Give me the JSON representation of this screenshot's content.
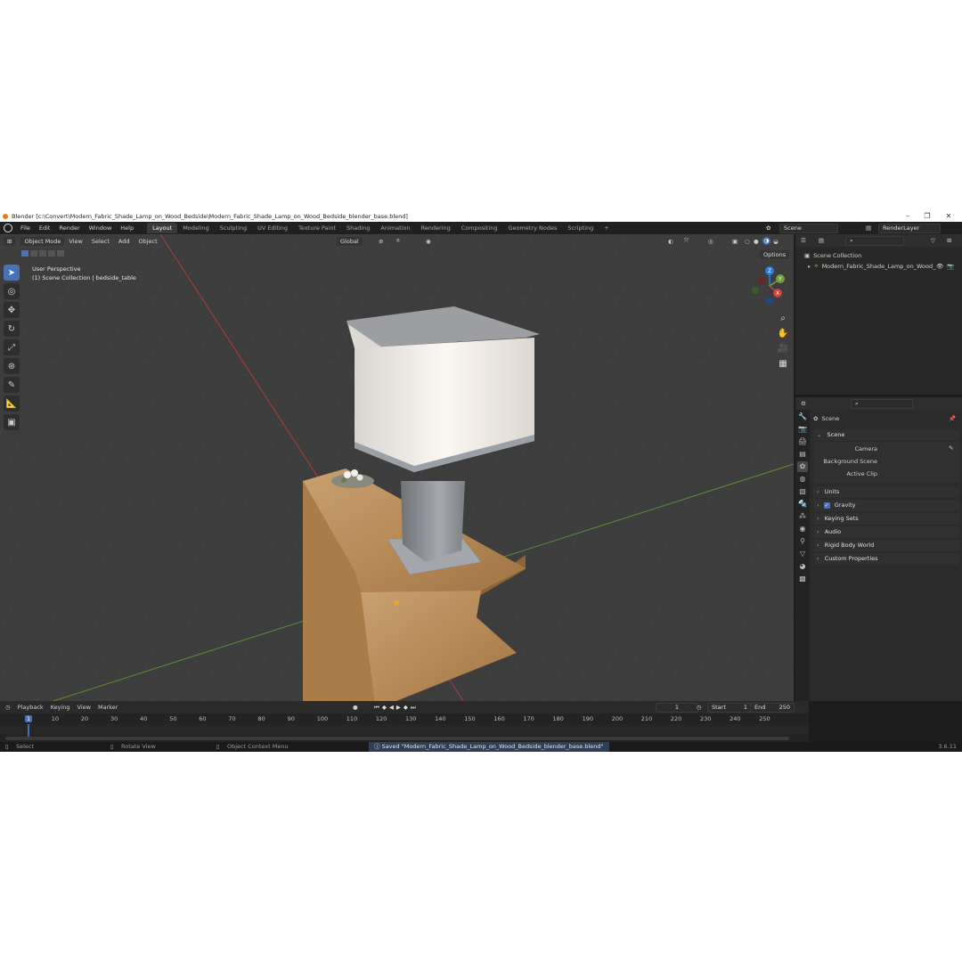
{
  "window": {
    "title": "Blender [c:\\Convert\\Modern_Fabric_Shade_Lamp_on_Wood_Bedside\\Modern_Fabric_Shade_Lamp_on_Wood_Bedside_blender_base.blend]",
    "minimize": "–",
    "maximize": "❐",
    "close": "✕"
  },
  "menu": [
    "File",
    "Edit",
    "Render",
    "Window",
    "Help"
  ],
  "workspaces": [
    "Layout",
    "Modeling",
    "Sculpting",
    "UV Editing",
    "Texture Paint",
    "Shading",
    "Animation",
    "Rendering",
    "Compositing",
    "Geometry Nodes",
    "Scripting"
  ],
  "workspace_add": "+",
  "scene_name": "Scene",
  "view_layer": "RenderLayer",
  "viewport_header": {
    "mode": "Object Mode",
    "menus": [
      "View",
      "Select",
      "Add",
      "Object"
    ],
    "transform_orientation": "Global",
    "options": "Options"
  },
  "viewport": {
    "perspective": "User Perspective",
    "collection_info": "(1) Scene Collection | bedside_table",
    "gizmo": {
      "z": "Z",
      "y": "Y",
      "x": "X"
    }
  },
  "outliner": {
    "root": "Scene Collection",
    "items": [
      "Modern_Fabric_Shade_Lamp_on_Wood_"
    ]
  },
  "properties": {
    "header": "Scene",
    "section": "Scene",
    "fields": [
      {
        "label": "Camera",
        "value": ""
      },
      {
        "label": "Background Scene",
        "value": ""
      },
      {
        "label": "Active Clip",
        "value": ""
      }
    ],
    "panels": [
      {
        "label": "Units",
        "checkbox": false
      },
      {
        "label": "Gravity",
        "checkbox": true
      },
      {
        "label": "Keying Sets",
        "checkbox": false
      },
      {
        "label": "Audio",
        "checkbox": false
      },
      {
        "label": "Rigid Body World",
        "checkbox": false
      },
      {
        "label": "Custom Properties",
        "checkbox": false
      }
    ]
  },
  "timeline": {
    "menus": [
      "Playback",
      "Keying",
      "View",
      "Marker"
    ],
    "current_frame": "1",
    "start_label": "Start",
    "start_value": "1",
    "end_label": "End",
    "end_value": "250",
    "ticks": [
      "1",
      "10",
      "20",
      "30",
      "40",
      "50",
      "60",
      "70",
      "80",
      "90",
      "100",
      "110",
      "120",
      "130",
      "140",
      "150",
      "160",
      "170",
      "180",
      "190",
      "200",
      "210",
      "220",
      "230",
      "240",
      "250"
    ]
  },
  "statusbar": {
    "select": "Select",
    "rotate": "Rotate View",
    "context_menu": "Object Context Menu",
    "message": "Saved \"Modern_Fabric_Shade_Lamp_on_Wood_Bedside_blender_base.blend\"",
    "version": "3.6.11"
  },
  "colors": {
    "accent": "#4772b3",
    "axis_x": "#d04040",
    "axis_y": "#6da33a",
    "gizmo_z": "#2f7bd6",
    "blender_orange": "#e87d0d"
  }
}
